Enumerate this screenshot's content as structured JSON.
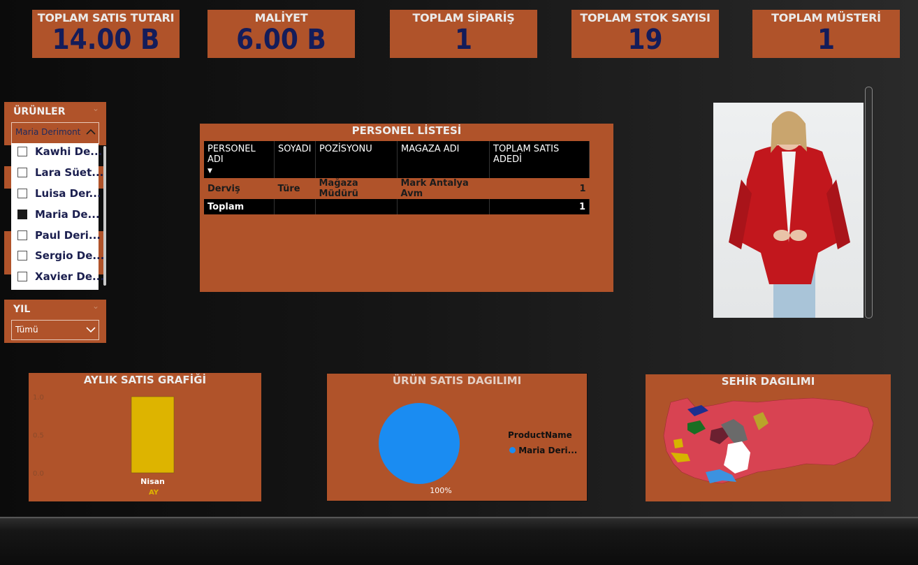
{
  "kpis": [
    {
      "title": "TOPLAM SATIS TUTARI",
      "value": "14.00 B"
    },
    {
      "title": "MALİYET",
      "value": "6.00 B"
    },
    {
      "title": "TOPLAM SİPARİŞ",
      "value": "1"
    },
    {
      "title": "TOPLAM STOK SAYISI",
      "value": "19"
    },
    {
      "title": "TOPLAM MÜSTERİ",
      "value": "1"
    }
  ],
  "urunler_slicer": {
    "header": "ÜRÜNLER",
    "selected": "Maria Derimont",
    "options": [
      {
        "label": "Kawhi De...",
        "checked": false
      },
      {
        "label": "Lara Süet...",
        "checked": false
      },
      {
        "label": "Luisa Der...",
        "checked": false
      },
      {
        "label": "Maria De...",
        "checked": true
      },
      {
        "label": "Paul Deri...",
        "checked": false
      },
      {
        "label": "Sergio De...",
        "checked": false
      },
      {
        "label": "Xavier De...",
        "checked": false
      }
    ]
  },
  "yil_slicer": {
    "header": "YIL",
    "selected": "Tümü"
  },
  "personel": {
    "title": "PERSONEL LİSTESİ",
    "columns": [
      "PERSONEL ADI",
      "SOYADI",
      "POZİSYONU",
      "MAGAZA ADI",
      "TOPLAM SATIS ADEDİ"
    ],
    "rows": [
      [
        "Derviş",
        "Türe",
        "Mağaza Müdürü",
        "Mark Antalya Avm",
        "1"
      ]
    ],
    "total": {
      "label": "Toplam",
      "value": "1"
    }
  },
  "monthly_chart": {
    "title": "AYLIK SATIS GRAFİĞİ",
    "axis_label": "AY"
  },
  "pie_chart": {
    "title": "ÜRÜN SATIS DAGILIMI",
    "legend_title": "ProductName",
    "legend_item": "Maria Deri...",
    "data_label": "100%"
  },
  "map": {
    "title": "SEHİR DAGILIMI"
  },
  "colors": {
    "panel": "#b0532a",
    "kpi_value": "#141c5a",
    "bar": "#ddb400",
    "pie": "#1a8cf2",
    "map_base": "#d84352"
  },
  "chart_data": [
    {
      "type": "bar",
      "title": "AYLIK SATIS GRAFİĞİ",
      "categories": [
        "Nisan"
      ],
      "values": [
        1.0
      ],
      "xlabel": "AY",
      "ylim": [
        0,
        1.0
      ],
      "yticks": [
        "1.0",
        "0.5",
        "0.0"
      ]
    },
    {
      "type": "pie",
      "title": "ÜRÜN SATIS DAGILIMI",
      "categories": [
        "Maria Deri..."
      ],
      "values": [
        100
      ]
    }
  ]
}
